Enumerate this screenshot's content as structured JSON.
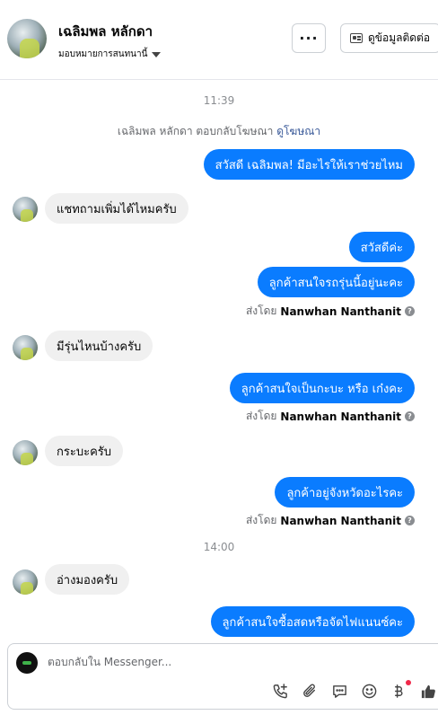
{
  "header": {
    "contact_name": "เฉลิมพล หลักดา",
    "assign_label": "มอบหมายการสนทนานี้",
    "more_label": "···",
    "contact_info_label": "ดูข้อมูลติดต่อ"
  },
  "conversation": {
    "time_1": "11:39",
    "system_note": "เฉลิมพล หลักดา ตอบกลับโฆษณา",
    "system_note_link": "ดูโฆษณา",
    "messages": [
      {
        "dir": "out",
        "text": "สวัสดี เฉลิมพล! มีอะไรให้เราช่วยไหม"
      },
      {
        "dir": "in",
        "text": "แชทถามเพิ่มได้ไหมครับ"
      },
      {
        "dir": "out",
        "text": "สวัสดีค่ะ"
      },
      {
        "dir": "out",
        "text": "ลูกค้าสนใจรถรุ่นนี้อยู่นะคะ"
      },
      {
        "dir": "in",
        "text": "มีรุ่นไหนบ้างครับ"
      },
      {
        "dir": "out",
        "text": "ลูกค้าสนใจเป็นกะบะ หรือ เก๋งคะ"
      },
      {
        "dir": "in",
        "text": "กระบะครับ"
      },
      {
        "dir": "out",
        "text": "ลูกค้าอยู่จังหวัดอะไรคะ"
      },
      {
        "dir": "in",
        "text": "อ่างมองครับ"
      },
      {
        "dir": "out",
        "text": "ลูกค้าสนใจซื้อสดหรือจัดไฟแนนซ์คะ"
      }
    ],
    "sent_by_prefix": "ส่งโดย",
    "sent_by_name": "Nanwhan Nanthanit",
    "time_2": "14:00"
  },
  "composer": {
    "placeholder": "ตอบกลับใน Messenger...",
    "accent_color": "#0a7cff"
  },
  "icons": [
    "add-call-icon",
    "attachment-icon",
    "saved-reply-icon",
    "emoji-icon",
    "baht-payment-icon",
    "thumbs-up-icon"
  ]
}
